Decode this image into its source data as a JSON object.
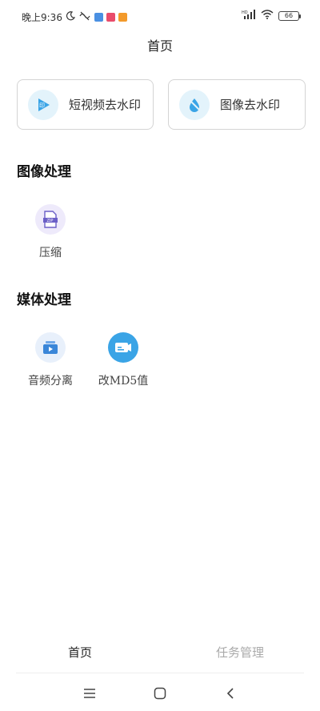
{
  "status_bar": {
    "time": "晚上9:36",
    "battery": "66",
    "colors": {
      "app_icon_blue": "#4a90e2",
      "app_icon_red": "#e94c6b",
      "app_icon_orange": "#f39a2b"
    }
  },
  "header": {
    "title": "首页"
  },
  "quick_tools": [
    {
      "label": "短视频去水印",
      "icon": "video-watermark-icon"
    },
    {
      "label": "图像去水印",
      "icon": "image-watermark-icon"
    }
  ],
  "image_section": {
    "title": "图像处理",
    "items": [
      {
        "label": "压缩",
        "icon": "zip-file-icon"
      }
    ]
  },
  "media_section": {
    "title": "媒体处理",
    "items": [
      {
        "label": "音频分离",
        "icon": "audio-separate-icon"
      },
      {
        "label": "改MD5值",
        "icon": "md5-card-icon"
      }
    ]
  },
  "bottom_tabs": [
    {
      "label": "首页",
      "active": true
    },
    {
      "label": "任务管理",
      "active": false
    }
  ],
  "colors": {
    "accent_blue": "#3aa4e6",
    "light_blue_bg": "#e3f3fb",
    "lavender_bg": "#eeeafb",
    "inactive_tab": "#aaaaaa"
  }
}
